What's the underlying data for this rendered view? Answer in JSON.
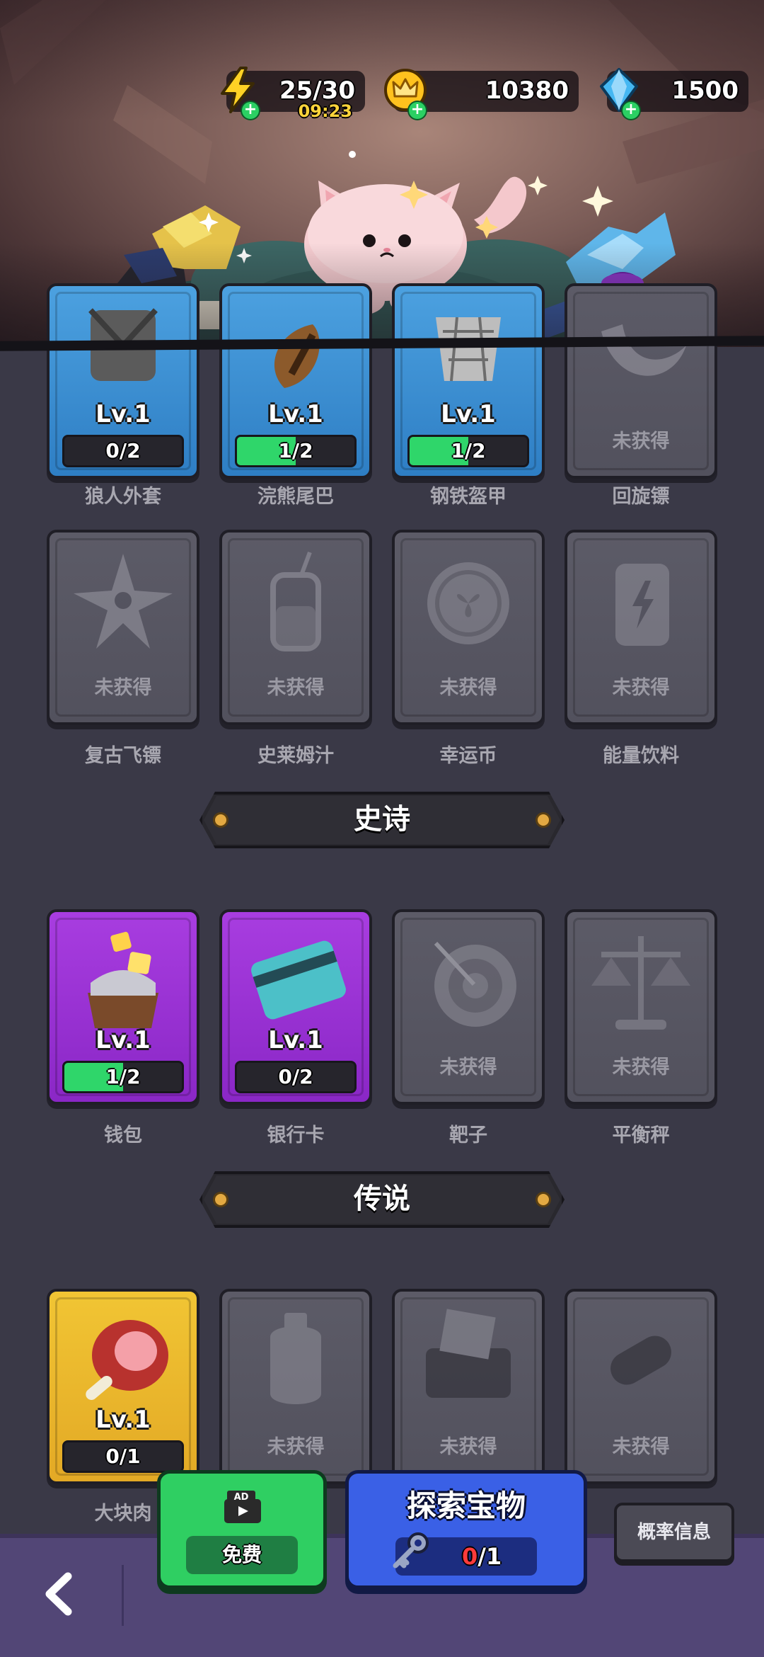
{
  "resources": {
    "energy": {
      "value": "25/30",
      "timer": "09:23",
      "icon": "lightning-icon",
      "plus": "+"
    },
    "gold": {
      "value": "10380",
      "icon": "crown-coin-icon",
      "plus": "+"
    },
    "gems": {
      "value": "1500",
      "icon": "gem-icon",
      "plus": "+"
    }
  },
  "rows": [
    {
      "items": [
        {
          "name": "狼人外套",
          "rarity": "blue",
          "level": "Lv.1",
          "progress": "0/2",
          "fill": 0
        },
        {
          "name": "浣熊尾巴",
          "rarity": "blue",
          "level": "Lv.1",
          "progress": "1/2",
          "fill": 0.5
        },
        {
          "name": "钢铁盔甲",
          "rarity": "blue",
          "level": "Lv.1",
          "progress": "1/2",
          "fill": 0.5
        },
        {
          "name": "回旋镖",
          "rarity": "gray",
          "status": "未获得"
        }
      ]
    },
    {
      "items": [
        {
          "name": "复古飞镖",
          "rarity": "gray",
          "status": "未获得"
        },
        {
          "name": "史莱姆汁",
          "rarity": "gray",
          "status": "未获得"
        },
        {
          "name": "幸运币",
          "rarity": "gray",
          "status": "未获得"
        },
        {
          "name": "能量饮料",
          "rarity": "gray",
          "status": "未获得"
        }
      ]
    },
    {
      "items": [
        {
          "name": "钱包",
          "rarity": "purple",
          "level": "Lv.1",
          "progress": "1/2",
          "fill": 0.5
        },
        {
          "name": "银行卡",
          "rarity": "purple",
          "level": "Lv.1",
          "progress": "0/2",
          "fill": 0
        },
        {
          "name": "靶子",
          "rarity": "gray",
          "status": "未获得"
        },
        {
          "name": "平衡秤",
          "rarity": "gray",
          "status": "未获得"
        }
      ]
    },
    {
      "items": [
        {
          "name": "大块肉",
          "rarity": "gold",
          "level": "Lv.1",
          "progress": "0/1",
          "fill": 0
        },
        {
          "name": "",
          "rarity": "gray",
          "status": "未获得"
        },
        {
          "name": "",
          "rarity": "gray",
          "status": "未获得"
        },
        {
          "name": "",
          "rarity": "gray",
          "status": "未获得"
        }
      ]
    }
  ],
  "sections": {
    "epic": "史诗",
    "legend": "传说"
  },
  "bottom": {
    "free": {
      "badge": "AD",
      "label": "免费"
    },
    "explore": {
      "title": "探索宝物",
      "have": "0",
      "sep": "/",
      "total": "1"
    },
    "probability": "概率信息",
    "back_icon": "chevron-left-icon"
  },
  "colors": {
    "blue": "#3a8fd6",
    "purple": "#9a33d6",
    "gold": "#eab52c",
    "gray": "#575662",
    "green": "#2fd66a"
  }
}
